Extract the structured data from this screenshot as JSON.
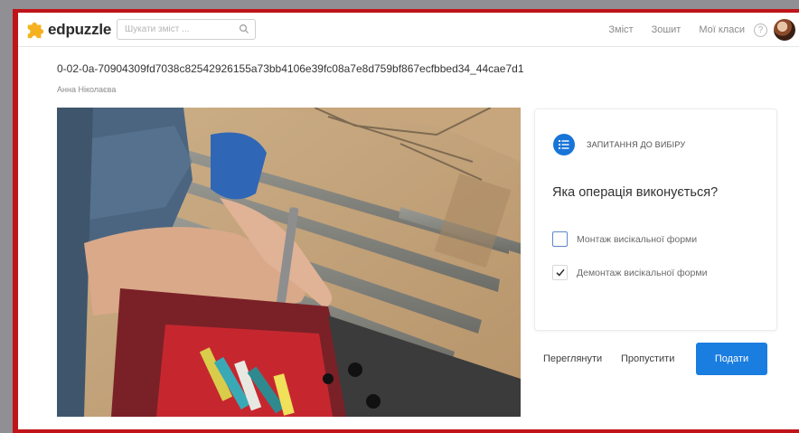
{
  "brand": {
    "name": "edpuzzle"
  },
  "search": {
    "placeholder": "Шукати зміст ..."
  },
  "nav": {
    "items": [
      {
        "label": "Зміст"
      },
      {
        "label": "Зошит"
      },
      {
        "label": "Мої класи"
      }
    ],
    "help_label": "?"
  },
  "video": {
    "title": "0-02-0a-70904309fd7038c82542926155a73bb4106e39fc08a7e8d759bf867ecfbbed34_44cae7d1",
    "author": "Анна Ніколаєва"
  },
  "question": {
    "type_label": "ЗАПИТАННЯ ДО ВИБІРУ",
    "text": "Яка операція виконується?",
    "options": [
      {
        "label": "Монтаж висікальної форми",
        "checked": false
      },
      {
        "label": "Демонтаж висікальної форми",
        "checked": true
      }
    ]
  },
  "actions": {
    "review_label": "Переглянути",
    "skip_label": "Пропустити",
    "submit_label": "Подати"
  },
  "colors": {
    "accent": "#1a7de0",
    "frame": "#c0141a",
    "logo": "#f5b21e"
  }
}
